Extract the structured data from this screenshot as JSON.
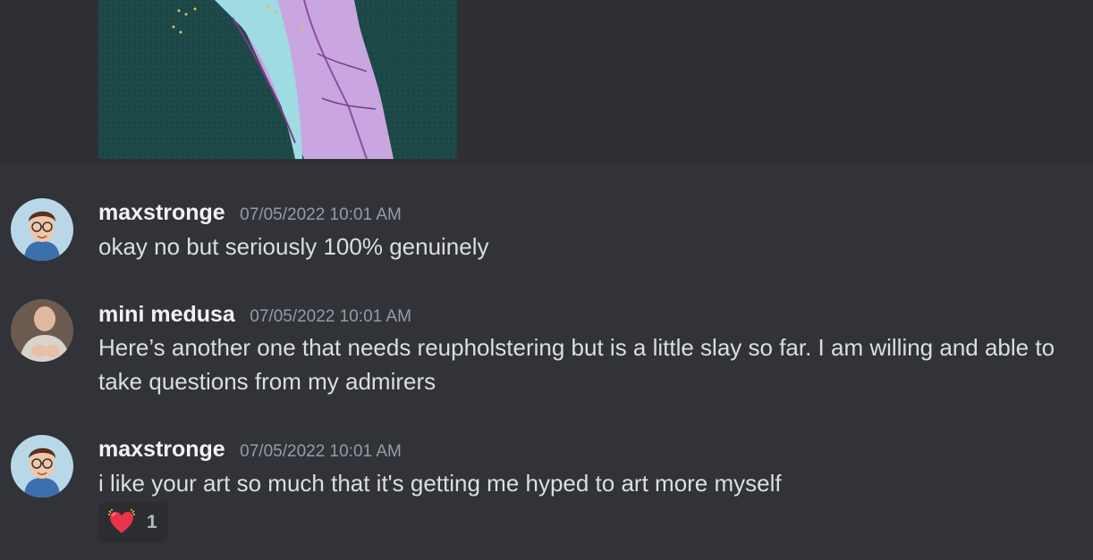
{
  "messages": [
    {
      "author": "maxstronge",
      "timestamp": "07/05/2022 10:01 AM",
      "text": "okay no but seriously 100% genuinely",
      "avatar": "cartoon-man-avatar"
    },
    {
      "author": "mini medusa",
      "timestamp": "07/05/2022 10:01 AM",
      "text": "Here’s another one that needs reupholstering but is a little slay so far. I am willing and able to take questions from my admirers",
      "avatar": "photo-avatar"
    },
    {
      "author": "maxstronge",
      "timestamp": "07/05/2022 10:01 AM",
      "text": "i like your art so much that it's getting me hyped to art more myself",
      "avatar": "cartoon-man-avatar",
      "reaction": {
        "emoji": "sparkling-heart-icon",
        "count": "1"
      }
    }
  ],
  "attachment": {
    "kind": "artwork-image",
    "background_color": "#1f4a4a"
  },
  "colors": {
    "background": "#313338",
    "username": "#f2f3f5",
    "timestamp": "#949ba4",
    "text": "#dbdee1",
    "reaction_bg": "#2b2d31"
  }
}
